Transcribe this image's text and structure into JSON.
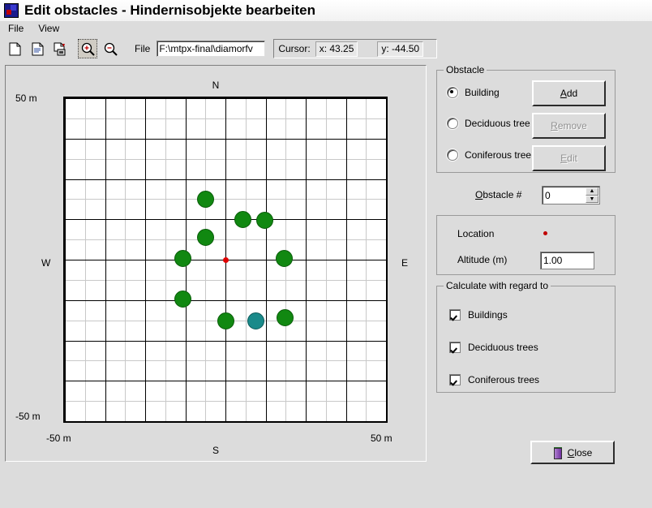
{
  "window": {
    "title": "Edit obstacles - Hindernisobjekte bearbeiten",
    "icon": "app-icon"
  },
  "menu": {
    "items": [
      {
        "label": "File"
      },
      {
        "label": "View"
      }
    ]
  },
  "toolbar": {
    "buttons": [
      {
        "name": "new-file-icon",
        "glyph": "new"
      },
      {
        "name": "open-file-icon",
        "glyph": "open"
      },
      {
        "name": "save-file-icon",
        "glyph": "save"
      },
      {
        "name": "zoom-in-icon",
        "glyph": "zoom-in",
        "selected": true
      },
      {
        "name": "zoom-out-icon",
        "glyph": "zoom-out"
      }
    ],
    "file_label": "File",
    "file_value": "F:\\mtpx-final\\diamorfv",
    "cursor_label": "Cursor:",
    "cursor_x": "x: 43.25",
    "cursor_y": "y: -44.50"
  },
  "map": {
    "label_north": "N",
    "label_south": "S",
    "label_west": "W",
    "label_east": "E",
    "label_top": "50 m",
    "label_bottom": "-50 m",
    "label_left_x": "-50 m",
    "label_right_x": "50 m"
  },
  "chart_data": {
    "type": "scatter",
    "title": "",
    "xlabel": "W  /  E",
    "ylabel": "S  /  N",
    "xlim": [
      -50,
      50
    ],
    "ylim": [
      -50,
      50
    ],
    "xticks": [
      -50,
      50
    ],
    "yticks": [
      -50,
      50
    ],
    "grid": true,
    "grid_major_step": 12.5,
    "grid_minor_step": 6.25,
    "center_marker": {
      "x": 0,
      "y": 0,
      "color": "#e00000",
      "name": "origin-marker"
    },
    "series": [
      {
        "name": "Buildings",
        "color": "#118811",
        "points": [
          {
            "x": -6.3,
            "y": 18.8
          },
          {
            "x": 5.5,
            "y": 12.5
          },
          {
            "x": 12.3,
            "y": 12.3
          },
          {
            "x": -6.3,
            "y": 7.0
          },
          {
            "x": -13.3,
            "y": 0.5
          },
          {
            "x": 18.3,
            "y": 0.3
          },
          {
            "x": -13.3,
            "y": -12.3
          },
          {
            "x": 0.0,
            "y": -19.0
          },
          {
            "x": 18.5,
            "y": -18.0
          }
        ]
      },
      {
        "name": "Selected obstacle",
        "color": "#1a8a8a",
        "points": [
          {
            "x": 9.5,
            "y": -19.0
          }
        ]
      }
    ]
  },
  "obstacle_group": {
    "title": "Obstacle",
    "radios": [
      {
        "label": "Building",
        "checked": true
      },
      {
        "label": "Deciduous tree",
        "checked": false
      },
      {
        "label": "Coniferous tree",
        "checked": false
      }
    ],
    "buttons": [
      {
        "label": "Add",
        "accel": "A",
        "disabled": false
      },
      {
        "label": "Remove",
        "accel": "R",
        "disabled": true
      },
      {
        "label": "Edit",
        "accel": "E",
        "disabled": true
      }
    ]
  },
  "obstacle_number": {
    "label": "Obstacle #",
    "accel": "O",
    "value": "0"
  },
  "location_group": {
    "location_label": "Location",
    "location_marker_color": "#c00000",
    "altitude_label": "Altitude (m)",
    "altitude_value": "1.00"
  },
  "calculate_group": {
    "title": "Calculate with regard to",
    "checkboxes": [
      {
        "label": "Buildings",
        "checked": true
      },
      {
        "label": "Deciduous trees",
        "checked": true
      },
      {
        "label": "Coniferous trees",
        "checked": true
      }
    ]
  },
  "footer": {
    "close_label": "Close",
    "close_accel": "C"
  }
}
